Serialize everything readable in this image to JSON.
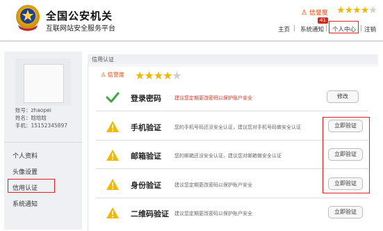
{
  "header": {
    "title": "全国公安机关",
    "subtitle": "互联网站安全服务平台",
    "credit_label": "信誉度",
    "message_count": "41",
    "stars": {
      "filled": 4,
      "total": 5
    },
    "nav": [
      "主页",
      "系统通知",
      "个人中心",
      "注销"
    ]
  },
  "sidebar": {
    "account": "账号：zhaopei",
    "name": "姓名：晗晗晗",
    "phone": "手机：15152345897",
    "items": [
      "个人资料",
      "头像设置",
      "信用认证",
      "系统通知"
    ],
    "active_item": "信用认证"
  },
  "main": {
    "panel_title": "信用认证",
    "credit_label": "信誉度",
    "stars": {
      "filled": 4,
      "total": 5
    },
    "rows": [
      {
        "title": "登录密码",
        "description": "建议您定期更改密码以保护账户安全",
        "status": "ok",
        "button": "修改"
      },
      {
        "title": "手机验证",
        "description": "您的手机号码还没安全认证，建议您对手机号码做安全认证",
        "status": "warning",
        "button": "立即验证"
      },
      {
        "title": "邮箱验证",
        "description": "您的邮箱还没安全认证，建议您对邮箱做安全认证",
        "status": "warning",
        "button": "立即验证"
      },
      {
        "title": "身份验证",
        "description": "建议您定期更改密码以保护账户安全",
        "status": "warning",
        "button": "立即验证"
      },
      {
        "title": "二维码验证",
        "description": "建议您定期更改密码以保护账户安全",
        "status": "warning",
        "button": "立即验证"
      }
    ]
  },
  "colors": {
    "highlight": "#e02020",
    "star": "#f2b705",
    "warning": "#f5b800",
    "check": "#3aa83a"
  }
}
